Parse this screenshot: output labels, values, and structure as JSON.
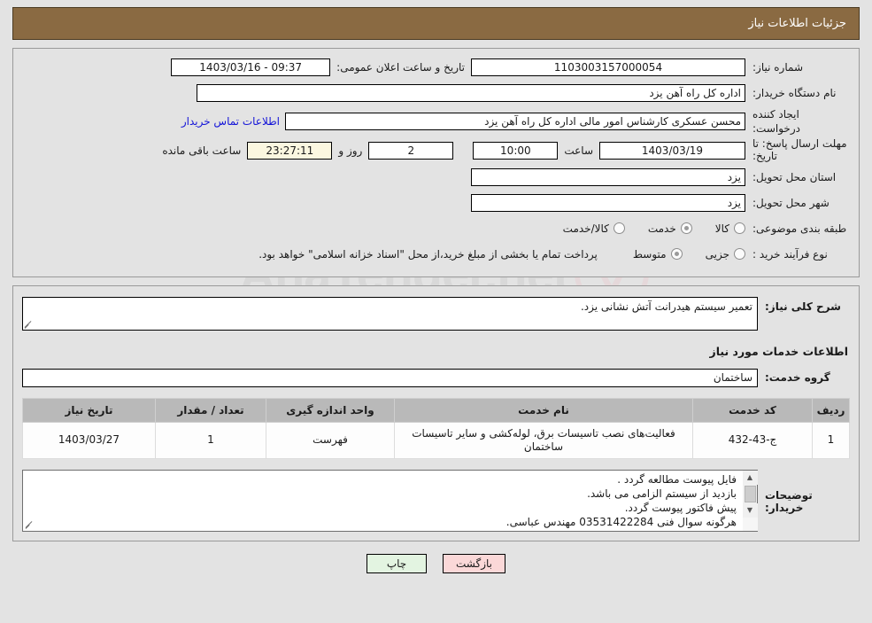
{
  "header": {
    "title": "جزئیات اطلاعات نیاز"
  },
  "watermark": {
    "text": "AnaTender.net"
  },
  "form": {
    "need_number_label": "شماره نیاز:",
    "need_number_value": "1103003157000054",
    "announce_label": "تاریخ و ساعت اعلان عمومی:",
    "announce_value": "09:37 - 1403/03/16",
    "buyer_org_label": "نام دستگاه خریدار:",
    "buyer_org_value": "اداره کل راه آهن یزد",
    "creator_label": "ایجاد کننده درخواست:",
    "creator_value": "محسن عسکری کارشناس امور مالی اداره کل راه آهن یزد",
    "contact_link": "اطلاعات تماس خریدار",
    "deadline_label": "مهلت ارسال پاسخ: تا تاریخ:",
    "deadline_date": "1403/03/19",
    "hour_label": "ساعت",
    "deadline_time": "10:00",
    "days_value": "2",
    "days_label": "روز و",
    "countdown_value": "23:27:11",
    "remaining_label": "ساعت باقی مانده",
    "province_label": "استان محل تحویل:",
    "province_value": "یزد",
    "city_label": "شهر محل تحویل:",
    "city_value": "یزد",
    "category_label": "طبقه بندی موضوعی:",
    "category_options": [
      {
        "label": "کالا",
        "selected": false
      },
      {
        "label": "خدمت",
        "selected": true
      },
      {
        "label": "کالا/خدمت",
        "selected": false
      }
    ],
    "process_label": "نوع فرآیند خرید :",
    "process_options": [
      {
        "label": "جزیی",
        "selected": false
      },
      {
        "label": "متوسط",
        "selected": true
      }
    ],
    "payment_note": "پرداخت تمام یا بخشی از مبلغ خرید،از محل \"اسناد خزانه اسلامی\" خواهد بود."
  },
  "description": {
    "label": "شرح کلی نیاز:",
    "value": "تعمیر سیستم هیدرانت آتش نشانی یزد."
  },
  "services_section": {
    "title": "اطلاعات خدمات مورد نیاز",
    "group_label": "گروه خدمت:",
    "group_value": "ساختمان"
  },
  "items_table": {
    "headers": [
      "ردیف",
      "کد خدمت",
      "نام خدمت",
      "واحد اندازه گیری",
      "تعداد / مقدار",
      "تاریخ نیاز"
    ],
    "rows": [
      {
        "index": "1",
        "code": "ج-43-432",
        "name": "فعالیت‌های نصب تاسیسات برق، لوله‌کشی و سایر تاسیسات ساختمان",
        "unit": "فهرست",
        "qty": "1",
        "date": "1403/03/27"
      }
    ]
  },
  "notes": {
    "label": "توضیحات خریدار:",
    "lines": [
      "فایل پیوست مطالعه گردد .",
      "بازدید از سیستم الزامی می باشد.",
      "پیش فاکتور پیوست گردد.",
      "هرگونه سوال فنی 03531422284 مهندس عباسی."
    ]
  },
  "footer": {
    "print_label": "چاپ",
    "back_label": "بازگشت"
  },
  "colors": {
    "header_brown": "#8a6a42",
    "page_bg": "#e3e3e3",
    "link_blue": "#1414d8",
    "countdown_bg": "#fbf7e0",
    "table_header_bg": "#b9b9b9",
    "print_btn_bg": "#e3f4e1",
    "back_btn_bg": "#fbd8d8"
  }
}
